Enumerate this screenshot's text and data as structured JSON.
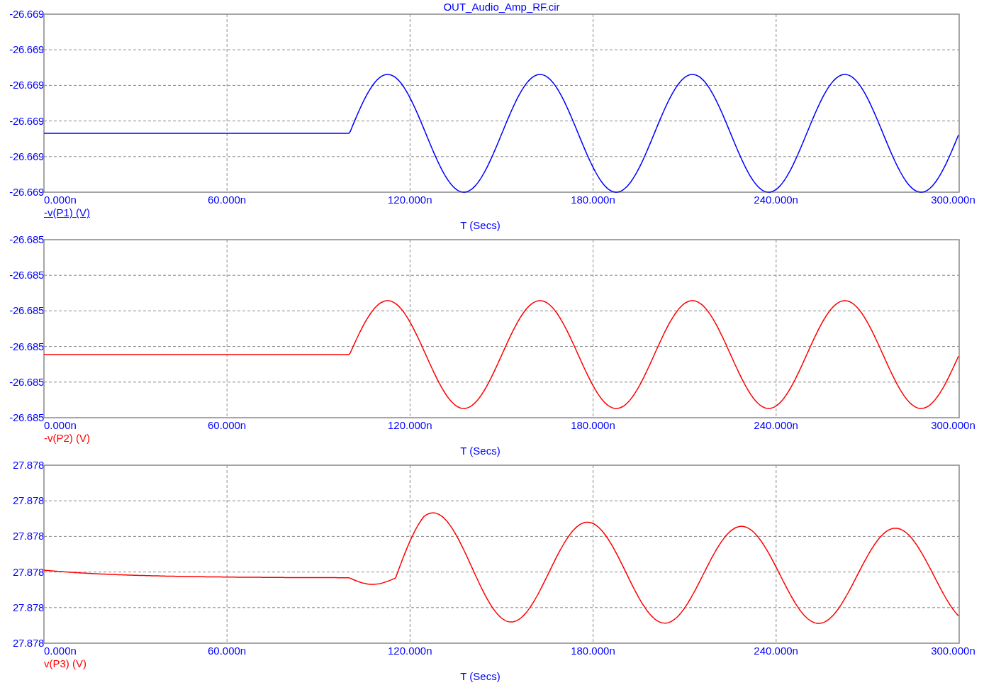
{
  "title": "OUT_Audio_Amp_RF.cir",
  "plots": [
    {
      "y_ticks": [
        "-26.669",
        "-26.669",
        "-26.669",
        "-26.669",
        "-26.669",
        "-26.669"
      ],
      "x_ticks": [
        "0.000n",
        "60.000n",
        "120.000n",
        "180.000n",
        "240.000n",
        "300.000n"
      ],
      "trace": {
        "label": "-v(P1) (V)",
        "color": "#0000ff",
        "kind": "step-sine",
        "selected": true
      },
      "x_axis_label": "T (Secs)"
    },
    {
      "y_ticks": [
        "-26.685",
        "-26.685",
        "-26.685",
        "-26.685",
        "-26.685",
        "-26.685"
      ],
      "x_ticks": [
        "0.000n",
        "60.000n",
        "120.000n",
        "180.000n",
        "240.000n",
        "300.000n"
      ],
      "trace": {
        "label": "-v(P2) (V)",
        "color": "#ff0000",
        "kind": "step-sine",
        "selected": false
      },
      "x_axis_label": "T (Secs)"
    },
    {
      "y_ticks": [
        "27.878",
        "27.878",
        "27.878",
        "27.878",
        "27.878",
        "27.878"
      ],
      "x_ticks": [
        "0.000n",
        "60.000n",
        "120.000n",
        "180.000n",
        "240.000n",
        "300.000n"
      ],
      "trace": {
        "label": "v(P3) (V)",
        "color": "#ff0000",
        "kind": "drifting-oscillation",
        "selected": false
      },
      "x_axis_label": "T (Secs)"
    }
  ]
}
